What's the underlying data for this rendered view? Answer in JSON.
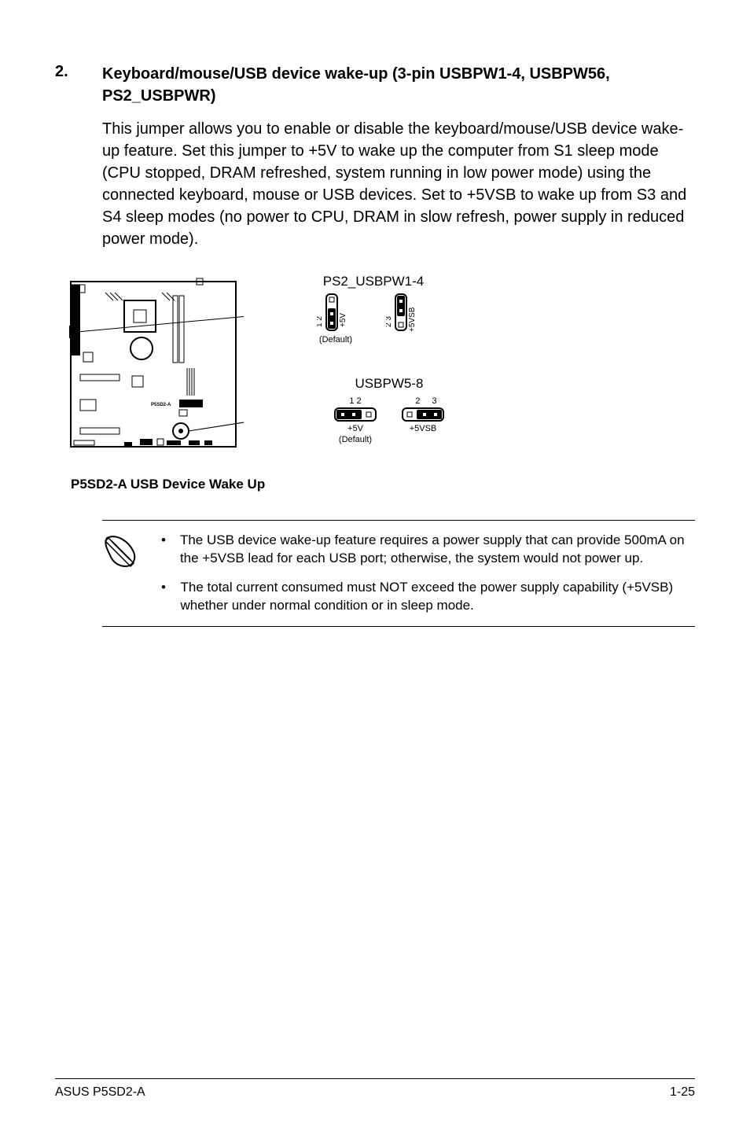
{
  "item_number": "2.",
  "heading": "Keyboard/mouse/USB device wake-up (3-pin USBPW1-4, USBPW56, PS2_USBPWR)",
  "body": "This jumper allows you to enable or disable the keyboard/mouse/USB device wake-up feature. Set this jumper to +5V to wake up the computer from S1 sleep mode (CPU stopped, DRAM refreshed, system running in low power mode) using the connected keyboard, mouse or USB devices. Set to +5VSB to wake up from S3 and S4 sleep modes (no power to CPU, DRAM in slow refresh, power supply in reduced power mode).",
  "diagram": {
    "board_label": "P5SD2-A",
    "jumper1": {
      "title": "PS2_USBPW1-4",
      "left": {
        "pins": "1 2",
        "voltage": "+5V",
        "note": "(Default)"
      },
      "right": {
        "pins": "2 3",
        "voltage": "+5VSB"
      }
    },
    "jumper2": {
      "title": "USBPW5-8",
      "left": {
        "pins": "1 2",
        "voltage": "+5V",
        "note": "(Default)"
      },
      "right": {
        "pins": "2 3",
        "voltage": "+5VSB"
      }
    },
    "caption": "P5SD2-A USB Device Wake Up"
  },
  "notes": [
    "The USB device wake-up feature requires a power supply that can provide 500mA on the +5VSB lead for each USB port; otherwise, the system would not power up.",
    "The total current consumed must NOT exceed the power supply capability (+5VSB) whether under normal condition or in sleep mode."
  ],
  "footer": {
    "left": "ASUS P5SD2-A",
    "right": "1-25"
  }
}
